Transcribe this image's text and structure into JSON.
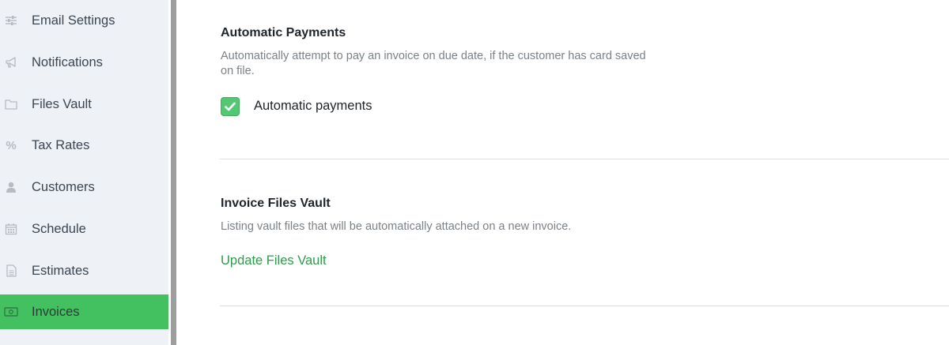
{
  "sidebar": {
    "items": [
      {
        "label": "Email Settings",
        "icon": "sliders-icon"
      },
      {
        "label": "Notifications",
        "icon": "megaphone-icon"
      },
      {
        "label": "Files Vault",
        "icon": "folder-icon"
      },
      {
        "label": "Tax Rates",
        "icon": "percent-icon"
      },
      {
        "label": "Customers",
        "icon": "user-icon"
      },
      {
        "label": "Schedule",
        "icon": "calendar-icon"
      },
      {
        "label": "Estimates",
        "icon": "document-icon"
      },
      {
        "label": "Invoices",
        "icon": "money-bill-icon",
        "active": true
      }
    ]
  },
  "automatic_payments": {
    "title": "Automatic Payments",
    "description": "Automatically attempt to pay an invoice on due date, if the customer has card saved on file.",
    "checkbox_label": "Automatic payments",
    "checked": true
  },
  "invoice_files_vault": {
    "title": "Invoice Files Vault",
    "description": "Listing vault files that will be automatically attached on a new invoice.",
    "link_label": "Update Files Vault"
  },
  "colors": {
    "accent": "#43c161",
    "link": "#2f9a4b",
    "sidebar_bg": "#eef1f6"
  }
}
